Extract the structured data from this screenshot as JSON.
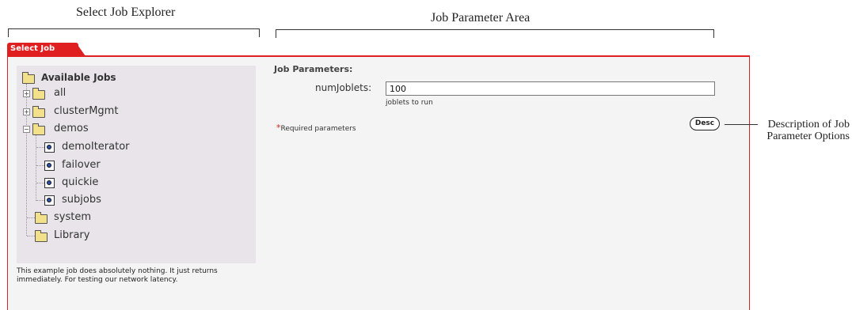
{
  "annotations": {
    "explorer_title": "Select Job Explorer",
    "params_area_title": "Job Parameter Area",
    "desc_callout": "Description of Job Parameter Options"
  },
  "tab": {
    "label": "Select Job"
  },
  "explorer": {
    "root": "Available Jobs",
    "items": [
      {
        "label": "all"
      },
      {
        "label": "clusterMgmt"
      },
      {
        "label": "demos"
      },
      {
        "label": "demoIterator"
      },
      {
        "label": "failover"
      },
      {
        "label": "quickie"
      },
      {
        "label": "subjobs"
      },
      {
        "label": "system"
      },
      {
        "label": "Library"
      }
    ],
    "description": "This example job does absolutely nothing. It just returns immediately. For testing our network latency."
  },
  "params": {
    "title": "Job Parameters:",
    "fields": [
      {
        "label": "numJoblets:",
        "value": "100",
        "help": "joblets to run"
      }
    ],
    "required_star": "*",
    "required_note": "Required parameters",
    "desc_button": "Desc"
  },
  "colors": {
    "accent": "#e02020",
    "tree_bg": "#e8e4ea",
    "panel_bg": "#f4f4f4"
  }
}
